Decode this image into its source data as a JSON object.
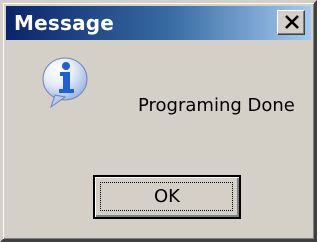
{
  "window": {
    "title": "Message",
    "close_icon": "close-icon"
  },
  "message": {
    "icon": "information-icon",
    "text": "Programing Done"
  },
  "buttons": {
    "ok_label": "OK"
  },
  "colors": {
    "title_gradient_start": "#0a246a",
    "title_gradient_end": "#a6caf0",
    "dialog_face": "#d4d0c8",
    "info_icon_blue": "#1c5fd6"
  }
}
